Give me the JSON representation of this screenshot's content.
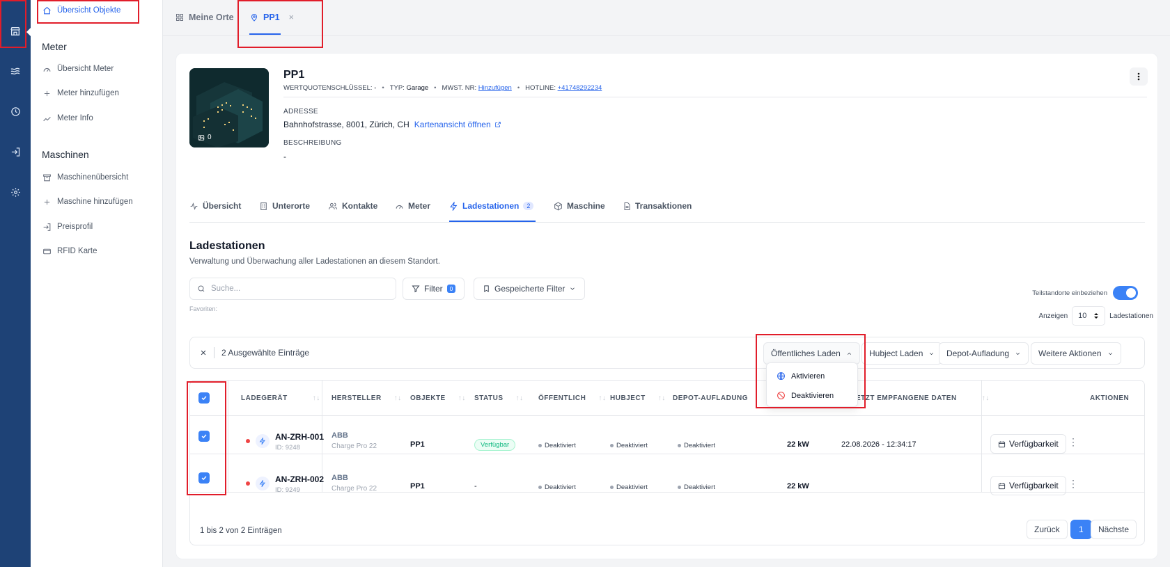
{
  "sidebar": {
    "sections": [
      {
        "title": "Meter"
      },
      {
        "title": "Maschinen"
      }
    ],
    "items": [
      {
        "label": "Übersicht Objekte"
      },
      {
        "label": "Übersicht Meter"
      },
      {
        "label": "Meter hinzufügen"
      },
      {
        "label": "Meter Info"
      },
      {
        "label": "Maschinenübersicht"
      },
      {
        "label": "Maschine hinzufügen"
      },
      {
        "label": "Preisprofil"
      },
      {
        "label": "RFID Karte"
      }
    ]
  },
  "top_tabs": [
    {
      "label": "Meine Orte"
    },
    {
      "label": "PP1",
      "close": "×"
    }
  ],
  "object": {
    "title": "PP1",
    "meta": {
      "key_label": "WERTQUOTENSCHLÜSSEL:",
      "key_value": "-",
      "type_label": "TYP:",
      "type_value": "Garage",
      "vat_label": "MWST. NR:",
      "vat_link": "Hinzufügen",
      "hotline_label": "HOTLINE:",
      "hotline_value": "+41748292234",
      "sep": "•"
    },
    "photo_count": "0",
    "address_label": "ADRESSE",
    "address": "Bahnhofstrasse, 8001, Zürich, CH",
    "map_link": "Kartenansicht öffnen",
    "description_label": "BESCHREIBUNG",
    "description": "-"
  },
  "detail_tabs": [
    {
      "label": "Übersicht"
    },
    {
      "label": "Unterorte"
    },
    {
      "label": "Kontakte"
    },
    {
      "label": "Meter"
    },
    {
      "label": "Ladestationen",
      "count": "2"
    },
    {
      "label": "Maschine"
    },
    {
      "label": "Transaktionen"
    }
  ],
  "section": {
    "title": "Ladestationen",
    "subtitle": "Verwaltung und Überwachung aller Ladestationen an diesem Standort."
  },
  "toolbar": {
    "search_placeholder": "Suche...",
    "filter_label": "Filter",
    "filter_count": "0",
    "saved_filters_label": "Gespeicherte Filter",
    "favorites_label": "Favoriten:",
    "include_sub_label": "Teilstandorte einbeziehen",
    "show_label": "Anzeigen",
    "page_size": "10",
    "show_suffix": "Ladestationen"
  },
  "bulk": {
    "selected_text": "2 Ausgewählte Einträge",
    "actions": [
      {
        "label": "Öffentliches Laden"
      },
      {
        "label": "Hubject Laden"
      },
      {
        "label": "Depot-Aufladung"
      },
      {
        "label": "Weitere Aktionen"
      }
    ],
    "dropdown": [
      {
        "label": "Aktivieren",
        "icon": "globe-icon"
      },
      {
        "label": "Deaktivieren",
        "icon": "ban-icon"
      }
    ]
  },
  "table": {
    "columns": [
      {
        "label": "LADEGERÄT"
      },
      {
        "label": "HERSTELLER"
      },
      {
        "label": "OBJEKTE"
      },
      {
        "label": "STATUS"
      },
      {
        "label": "ÖFFENTLICH"
      },
      {
        "label": "HUBJECT"
      },
      {
        "label": "DEPOT-AUFLADUNG"
      },
      {
        "label": "ZULETZT EMPFANGENE DATEN"
      },
      {
        "label": "AKTIONEN"
      }
    ],
    "rows": [
      {
        "name": "AN-ZRH-001",
        "id": "ID: 9248",
        "manufacturer": "ABB",
        "model": "Charge Pro 22",
        "object": "PP1",
        "status": "Verfügbar",
        "public": "Deaktiviert",
        "hubject": "Deaktiviert",
        "depot": "Deaktiviert",
        "power": "22 kW",
        "last_data": "22.08.2026 - 12:34:17",
        "action": "Verfügbarkeit"
      },
      {
        "name": "AN-ZRH-002",
        "id": "ID: 9249",
        "manufacturer": "ABB",
        "model": "Charge Pro 22",
        "object": "PP1",
        "status": "-",
        "public": "Deaktiviert",
        "hubject": "Deaktiviert",
        "depot": "Deaktiviert",
        "power": "22 kW",
        "last_data": "",
        "action": "Verfügbarkeit"
      }
    ]
  },
  "pagination": {
    "info": "1 bis 2 von 2 Einträgen",
    "prev": "Zurück",
    "current": "1",
    "next": "Nächste"
  },
  "colors": {
    "rail": "#1e4276",
    "accent": "#3b82f6",
    "annotation": "#e11d2a"
  }
}
